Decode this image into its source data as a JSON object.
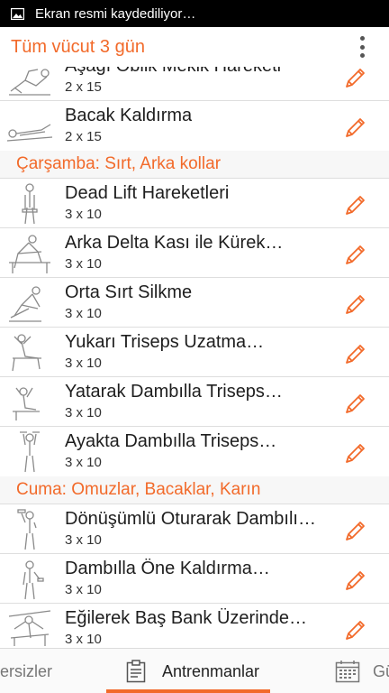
{
  "status_bar": {
    "text": "Ekran resmi kaydediliyor…",
    "icon": "image-icon"
  },
  "app_bar": {
    "title": "Tüm vücut 3 gün",
    "menu_icon": "more-vert-icon"
  },
  "colors": {
    "accent": "#f26a2a",
    "status_bar": "#000000",
    "section_bg": "#f7f7f7"
  },
  "exercises_top": [
    {
      "name": "Aşağı Oblik Mekik Hareketi",
      "sets": "2 x 15"
    },
    {
      "name": "Bacak Kaldırma",
      "sets": "2 x 15"
    }
  ],
  "sections": [
    {
      "title": "Çarşamba: Sırt, Arka kollar",
      "exercises": [
        {
          "name": "Dead Lift Hareketleri",
          "sets": "3 x 10"
        },
        {
          "name": "Arka Delta Kası ile Kürek…",
          "sets": "3 x 10"
        },
        {
          "name": "Orta Sırt Silkme",
          "sets": "3 x 10"
        },
        {
          "name": "Yukarı Triseps Uzatma…",
          "sets": "3 x 10"
        },
        {
          "name": "Yatarak Dambılla Triseps…",
          "sets": "3 x 10"
        },
        {
          "name": "Ayakta Dambılla Triseps…",
          "sets": "3 x 10"
        }
      ]
    },
    {
      "title": "Cuma: Omuzlar, Bacaklar, Karın",
      "exercises": [
        {
          "name": "Dönüşümlü Oturarak Dambılı…",
          "sets": "3 x 10"
        },
        {
          "name": "Dambılla Öne Kaldırma…",
          "sets": "3 x 10"
        },
        {
          "name": "Eğilerek Baş Bank Üzerinde…",
          "sets": "3 x 10"
        }
      ]
    }
  ],
  "bottom_nav": {
    "tabs": [
      {
        "label": "ersizler",
        "icon": ""
      },
      {
        "label": "Antrenmanlar",
        "icon": "clipboard-icon"
      },
      {
        "label": "Gü",
        "icon": "calendar-icon"
      }
    ]
  }
}
